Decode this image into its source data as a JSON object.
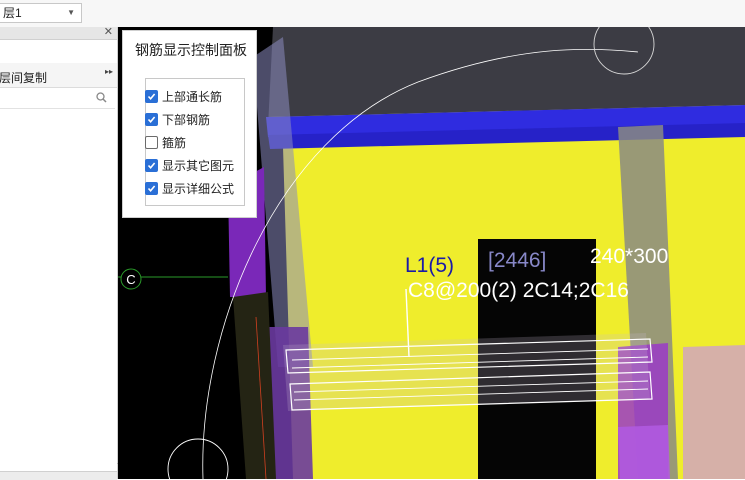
{
  "toolbar": {
    "floor_value": "层1"
  },
  "left_panel": {
    "tab_label": "层间复制"
  },
  "rebar_panel": {
    "title": "钢筋显示控制面板",
    "options": [
      {
        "label": "上部通长筋",
        "checked": true
      },
      {
        "label": "下部钢筋",
        "checked": true
      },
      {
        "label": "箍筋",
        "checked": false
      },
      {
        "label": "显示其它图元",
        "checked": true
      },
      {
        "label": "显示详细公式",
        "checked": true
      }
    ]
  },
  "viewport": {
    "axis_label": "C",
    "beam_line1_a": "L1(5)",
    "beam_line1_b": "[2446]",
    "beam_line1_c": "240*300",
    "beam_line2": "C8@200(2) 2C14;2C16",
    "colors": {
      "background": "#000000",
      "wall": "#efed2c",
      "slab": "#2f2ce0",
      "column": "#7f7f8f",
      "purple_column": "#7a28b8",
      "annotation_blue": "#1a1aa8",
      "annotation_white": "#ffffff"
    }
  }
}
